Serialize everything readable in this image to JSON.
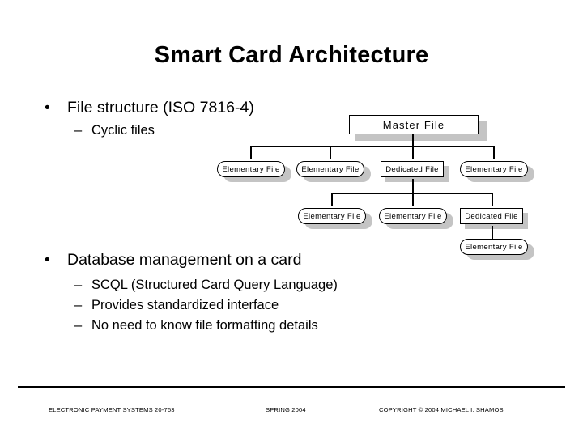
{
  "slide": {
    "title": "Smart Card Architecture",
    "background_color": "#ffffff",
    "text_color": "#000000"
  },
  "content": {
    "bullets": [
      {
        "label": "File structure (ISO 7816-4)",
        "marker": "•",
        "sub": [
          {
            "marker": "–",
            "label": "Cyclic files"
          }
        ]
      },
      {
        "label": "Database management on a card",
        "marker": "•",
        "sub": [
          {
            "marker": "–",
            "label": "SCQL (Structured Card Query Language)"
          },
          {
            "marker": "–",
            "label": "Provides standardized interface"
          },
          {
            "marker": "–",
            "label": "No need to know file formatting details"
          }
        ]
      }
    ]
  },
  "diagram": {
    "title": "ISO 7816-4 smart card file structure tree",
    "shadow_color": "#c4c4c4",
    "node_border_color": "#000000",
    "node_fill_color": "#ffffff",
    "nodes": [
      {
        "id": "mf",
        "label": "Master  File",
        "shape": "rect",
        "level": 0
      },
      {
        "id": "ef1",
        "label": "Elementary  File",
        "shape": "rounded",
        "level": 1
      },
      {
        "id": "ef2",
        "label": "Elementary  File",
        "shape": "rounded",
        "level": 1
      },
      {
        "id": "df1",
        "label": "Dedicated  File",
        "shape": "rect",
        "level": 1
      },
      {
        "id": "ef3",
        "label": "Elementary  File",
        "shape": "rounded",
        "level": 1
      },
      {
        "id": "ef4",
        "label": "Elementary  File",
        "shape": "rounded",
        "level": 2
      },
      {
        "id": "ef5",
        "label": "Elementary  File",
        "shape": "rounded",
        "level": 2
      },
      {
        "id": "df2",
        "label": "Dedicated  File",
        "shape": "rect",
        "level": 2
      },
      {
        "id": "ef6",
        "label": "Elementary  File",
        "shape": "rounded",
        "level": 3
      }
    ],
    "edges": [
      {
        "from": "mf",
        "to": "ef1"
      },
      {
        "from": "mf",
        "to": "ef2"
      },
      {
        "from": "mf",
        "to": "df1"
      },
      {
        "from": "mf",
        "to": "ef3"
      },
      {
        "from": "df1",
        "to": "ef4"
      },
      {
        "from": "df1",
        "to": "ef5"
      },
      {
        "from": "df1",
        "to": "df2"
      },
      {
        "from": "df2",
        "to": "ef6"
      }
    ]
  },
  "footer": {
    "left": "ELECTRONIC PAYMENT SYSTEMS 20-763",
    "center": "SPRING 2004",
    "right": "COPYRIGHT © 2004 MICHAEL I. SHAMOS"
  }
}
